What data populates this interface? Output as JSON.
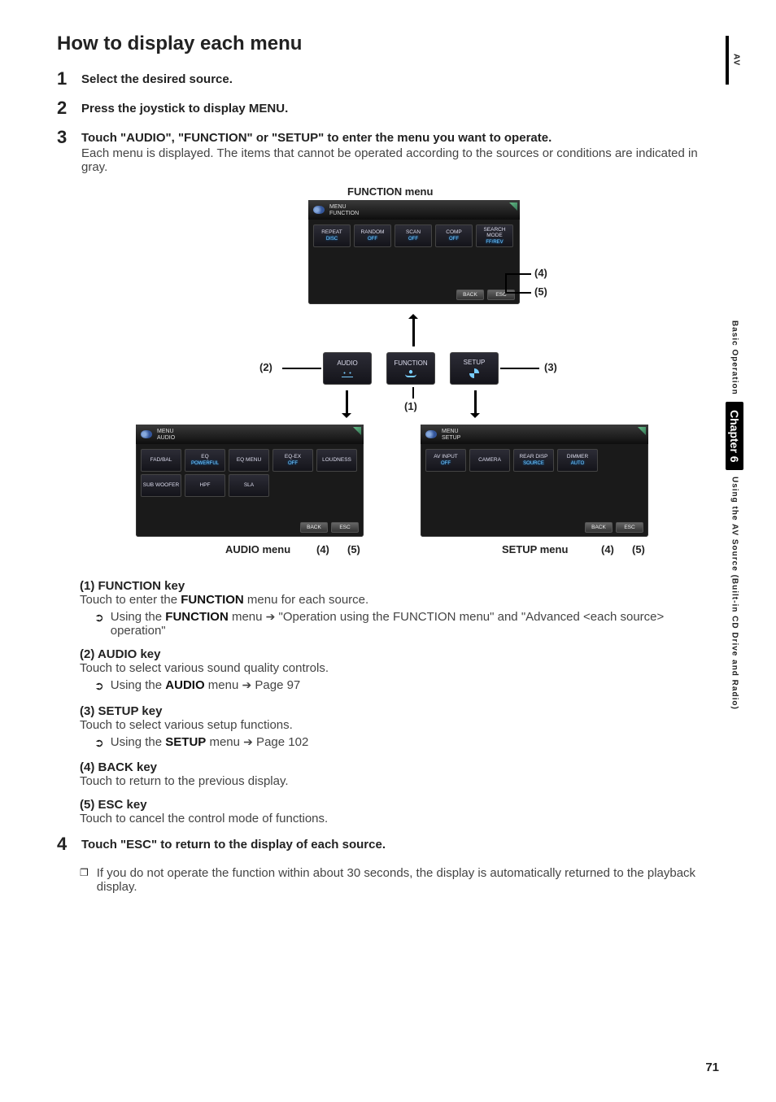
{
  "sidebar": {
    "av": "AV",
    "basic": "Basic Operation",
    "chapter": "Chapter 6",
    "using": "Using the AV Source (Built-in CD Drive and Radio)"
  },
  "title": "How to display each menu",
  "steps": {
    "s1": {
      "num": "1",
      "title": "Select the desired source."
    },
    "s2": {
      "num": "2",
      "title_pre": "Press the joystick to display ",
      "title_bold": "MENU",
      "title_post": "."
    },
    "s3": {
      "num": "3",
      "title": "Touch \"AUDIO\", \"FUNCTION\" or \"SETUP\" to enter the menu you want to operate.",
      "desc": "Each menu is displayed. The items that cannot be operated according to the sources or conditions are indicated in gray."
    },
    "s4": {
      "num": "4",
      "title": "Touch \"ESC\" to return to the display of each source.",
      "note": "If you do not operate the function within about 30 seconds, the display is automatically returned to the playback display."
    }
  },
  "diagram": {
    "func_caption": "FUNCTION menu",
    "audio_caption": "AUDIO menu",
    "setup_caption": "SETUP menu",
    "callout_1": "(1)",
    "callout_2": "(2)",
    "callout_3": "(3)",
    "callout_4": "(4)",
    "callout_5": "(5)",
    "hdr_menu": "MENU",
    "hdr_function": "FUNCTION",
    "hdr_audio": "AUDIO",
    "hdr_setup": "SETUP",
    "func_btns": [
      {
        "lbl": "REPEAT",
        "val": "DISC"
      },
      {
        "lbl": "RANDOM",
        "val": "OFF"
      },
      {
        "lbl": "SCAN",
        "val": "OFF"
      },
      {
        "lbl": "COMP",
        "val": "OFF"
      },
      {
        "lbl": "SEARCH MODE",
        "val": "FF/REV"
      }
    ],
    "audio_btns_r1": [
      {
        "lbl": "FAD/BAL",
        "val": ""
      },
      {
        "lbl": "EQ",
        "val": "POWERFUL"
      },
      {
        "lbl": "EQ MENU",
        "val": ""
      },
      {
        "lbl": "EQ-EX",
        "val": "OFF"
      },
      {
        "lbl": "LOUDNESS",
        "val": ""
      }
    ],
    "audio_btns_r2": [
      {
        "lbl": "SUB WOOFER",
        "val": ""
      },
      {
        "lbl": "HPF",
        "val": ""
      },
      {
        "lbl": "SLA",
        "val": ""
      }
    ],
    "setup_btns": [
      {
        "lbl": "AV INPUT",
        "val": "OFF"
      },
      {
        "lbl": "CAMERA",
        "val": ""
      },
      {
        "lbl": "REAR DISP",
        "val": "SOURCE"
      },
      {
        "lbl": "DIMMER",
        "val": "AUTO"
      }
    ],
    "mid": {
      "audio": "AUDIO",
      "function": "FUNCTION",
      "setup": "SETUP"
    },
    "back": "BACK",
    "esc": "ESC"
  },
  "keys": {
    "k1": {
      "head": "(1) FUNCTION key",
      "desc_pre": "Touch to enter the ",
      "desc_bold": "FUNCTION",
      "desc_post": " menu for each source.",
      "ref_pre": "Using the ",
      "ref_bold": "FUNCTION",
      "ref_mid": " menu ",
      "ref_post": " \"Operation using the FUNCTION menu\" and \"Advanced <each source> operation\""
    },
    "k2": {
      "head": "(2) AUDIO key",
      "desc": "Touch to select various sound quality controls.",
      "ref_pre": "Using the ",
      "ref_bold": "AUDIO",
      "ref_mid": " menu ",
      "ref_post": " Page 97"
    },
    "k3": {
      "head": "(3) SETUP key",
      "desc": "Touch to select various setup functions.",
      "ref_pre": "Using the ",
      "ref_bold": "SETUP",
      "ref_mid": " menu ",
      "ref_post": " Page 102"
    },
    "k4": {
      "head": "(4) BACK key",
      "desc": "Touch to return to the previous display."
    },
    "k5": {
      "head": "(5) ESC key",
      "desc": "Touch to cancel the control mode of functions."
    }
  },
  "page_number": "71"
}
